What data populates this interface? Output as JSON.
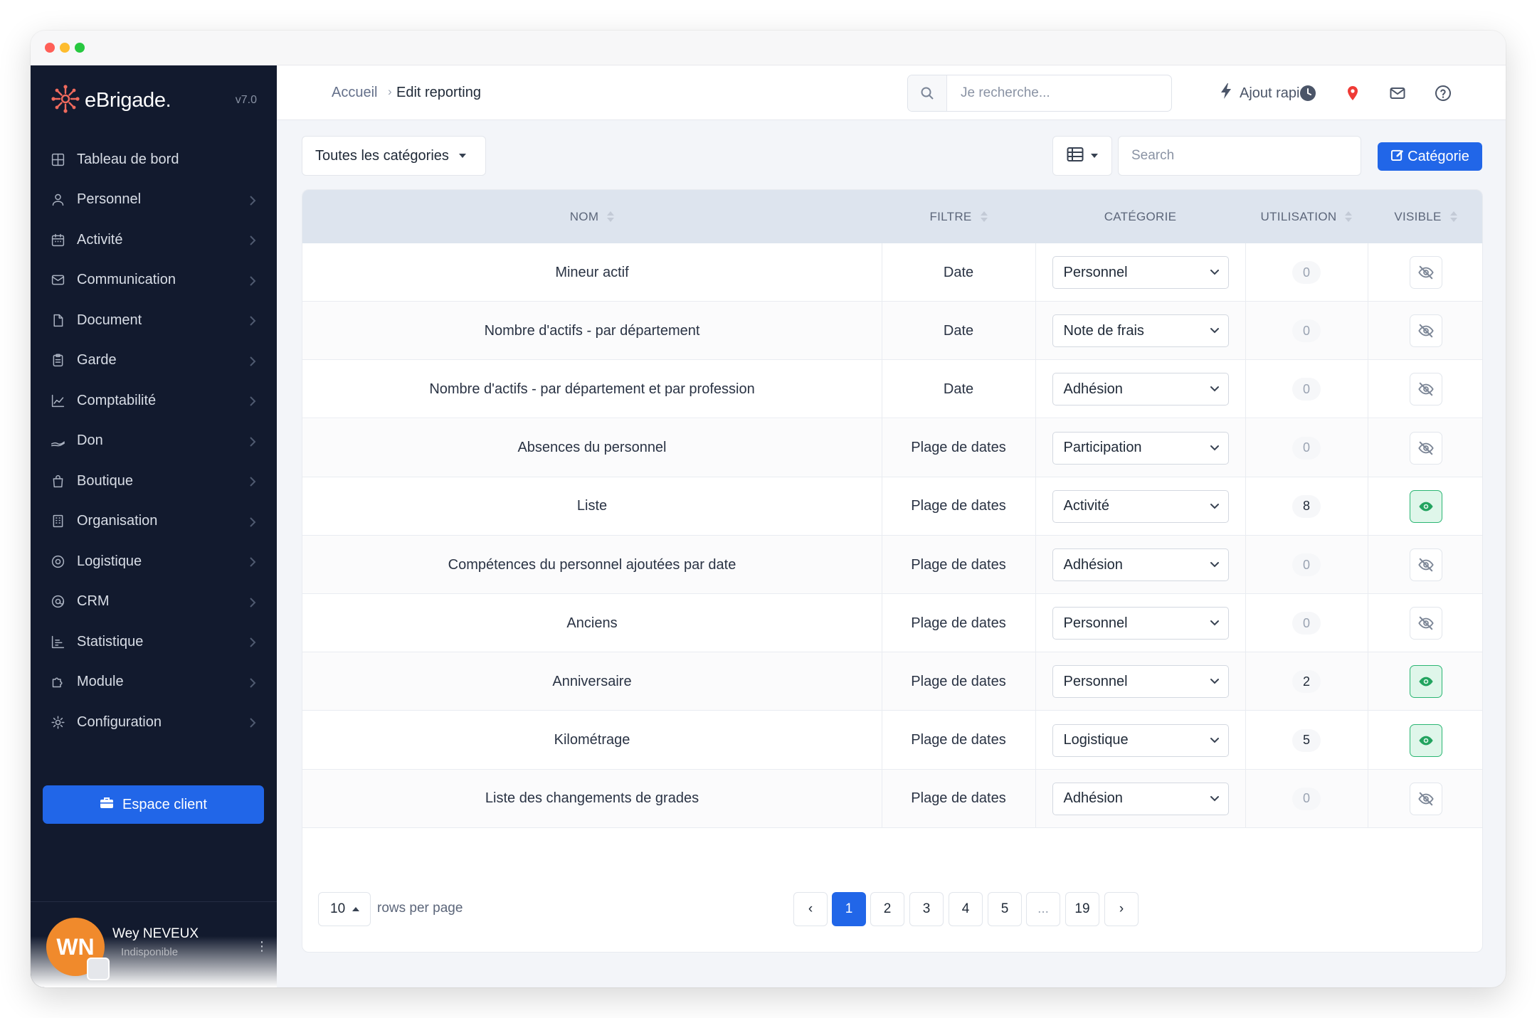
{
  "app": {
    "brand": "eBrigade.",
    "version": "v7.0",
    "accent": "#2166e8",
    "sidebar_bg": "#121a2e"
  },
  "sidebar": {
    "items": [
      {
        "label": "Tableau de bord",
        "icon": "dashboard-icon"
      },
      {
        "label": "Personnel",
        "icon": "user-icon"
      },
      {
        "label": "Activité",
        "icon": "calendar-icon"
      },
      {
        "label": "Communication",
        "icon": "envelope-icon"
      },
      {
        "label": "Document",
        "icon": "file-icon"
      },
      {
        "label": "Garde",
        "icon": "clipboard-icon"
      },
      {
        "label": "Comptabilité",
        "icon": "line-chart-icon"
      },
      {
        "label": "Don",
        "icon": "hand-coin-icon"
      },
      {
        "label": "Boutique",
        "icon": "shopping-bag-icon"
      },
      {
        "label": "Organisation",
        "icon": "building-icon"
      },
      {
        "label": "Logistique",
        "icon": "target-icon"
      },
      {
        "label": "CRM",
        "icon": "at-icon"
      },
      {
        "label": "Statistique",
        "icon": "bar-chart-icon"
      },
      {
        "label": "Module",
        "icon": "puzzle-icon"
      },
      {
        "label": "Configuration",
        "icon": "gear-icon"
      }
    ],
    "espace_client": "Espace client",
    "user": {
      "initials": "WN",
      "name": "Wey NEVEUX",
      "status": "Indisponible"
    }
  },
  "topbar": {
    "breadcrumb_home": "Accueil",
    "breadcrumb_sep": "›",
    "breadcrumb_current": "Edit reporting",
    "search_placeholder": "Je recherche...",
    "quick_add": "Ajout rapide"
  },
  "toolbar": {
    "category_filter": "Toutes les catégories",
    "search_placeholder": "Search",
    "category_button": "Catégorie"
  },
  "table": {
    "columns": [
      "NOM",
      "FILTRE",
      "CATÉGORIE",
      "UTILISATION",
      "VISIBLE"
    ],
    "rows": [
      {
        "nom": "Mineur actif",
        "filtre": "Date",
        "categorie": "Personnel",
        "utilisation": "0",
        "visible": false
      },
      {
        "nom": "Nombre d'actifs - par département",
        "filtre": "Date",
        "categorie": "Note de frais",
        "utilisation": "0",
        "visible": false
      },
      {
        "nom": "Nombre d'actifs - par département et par profession",
        "filtre": "Date",
        "categorie": "Adhésion",
        "utilisation": "0",
        "visible": false
      },
      {
        "nom": "Absences du personnel",
        "filtre": "Plage de dates",
        "categorie": "Participation",
        "utilisation": "0",
        "visible": false
      },
      {
        "nom": "Liste",
        "filtre": "Plage de dates",
        "categorie": "Activité",
        "utilisation": "8",
        "visible": true
      },
      {
        "nom": "Compétences du personnel ajoutées par date",
        "filtre": "Plage de dates",
        "categorie": "Adhésion",
        "utilisation": "0",
        "visible": false
      },
      {
        "nom": "Anciens",
        "filtre": "Plage de dates",
        "categorie": "Personnel",
        "utilisation": "0",
        "visible": false
      },
      {
        "nom": "Anniversaire",
        "filtre": "Plage de dates",
        "categorie": "Personnel",
        "utilisation": "2",
        "visible": true
      },
      {
        "nom": "Kilométrage",
        "filtre": "Plage de dates",
        "categorie": "Logistique",
        "utilisation": "5",
        "visible": true
      },
      {
        "nom": "Liste des changements de grades",
        "filtre": "Plage de dates",
        "categorie": "Adhésion",
        "utilisation": "0",
        "visible": false
      }
    ]
  },
  "pagination": {
    "page_size": "10",
    "rows_label": "rows per page",
    "prev": "‹",
    "next": "›",
    "pages": [
      "1",
      "2",
      "3",
      "4",
      "5",
      "...",
      "19"
    ],
    "current": "1"
  }
}
